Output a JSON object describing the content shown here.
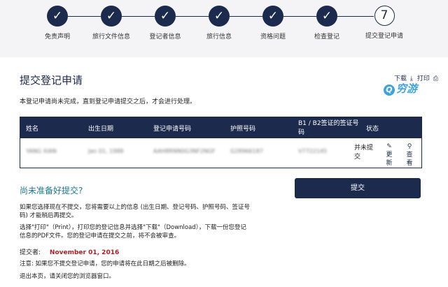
{
  "steps": [
    {
      "label": "免责声明",
      "mark": "✓"
    },
    {
      "label": "旅行文件信息",
      "mark": "✓"
    },
    {
      "label": "登记者信息",
      "mark": "✓"
    },
    {
      "label": "旅行信息",
      "mark": "✓"
    },
    {
      "label": "资格问题",
      "mark": "✓"
    },
    {
      "label": "检查登记",
      "mark": "✓"
    },
    {
      "label": "提交登记申请",
      "mark": "7"
    }
  ],
  "page": {
    "title": "提交登记申请",
    "intro": "本登记申请尚未完成，直到登记申请提交之后，才会进行处理。"
  },
  "tools": {
    "download": "下载",
    "print": "打印"
  },
  "watermark": "穷游",
  "table": {
    "headers": {
      "name": "姓名",
      "dob": "出生日期",
      "app_no": "登记申请号码",
      "passport": "护照号码",
      "visa": "B1 / B2签证的签证号码",
      "status": "状态"
    },
    "row": {
      "name": "YANG XIAN",
      "dob": "Jan 01, 1988",
      "app_no": "AAH8RNN0G3NF2NGF",
      "passport": "G28966187",
      "visa": "V7722145",
      "status": "并未提交",
      "update": "更新",
      "view": "查看"
    }
  },
  "not_ready": {
    "title": "尚未准备好提交?",
    "p1": "如果您选择现在不提交，您将需要以上的信息 (出生日期、登记号码、护照号码、签证号码) 才能稍后再提交。",
    "p2": "选择\"打印\"（Print），打印您的登记信息并选择\"下载\"（Download），下载一份您登记信息的PDF文件。您的登记申请在提交之前，将不会被审查。"
  },
  "submit_label": "提交",
  "submitter": {
    "label": "提交者:",
    "date": "November 01, 2016"
  },
  "note": "注意: 如果您不提交登记申请，您的申请将在此日期之后被删除。",
  "exit_note": "退出本页，请关闭您的浏览器窗口。"
}
